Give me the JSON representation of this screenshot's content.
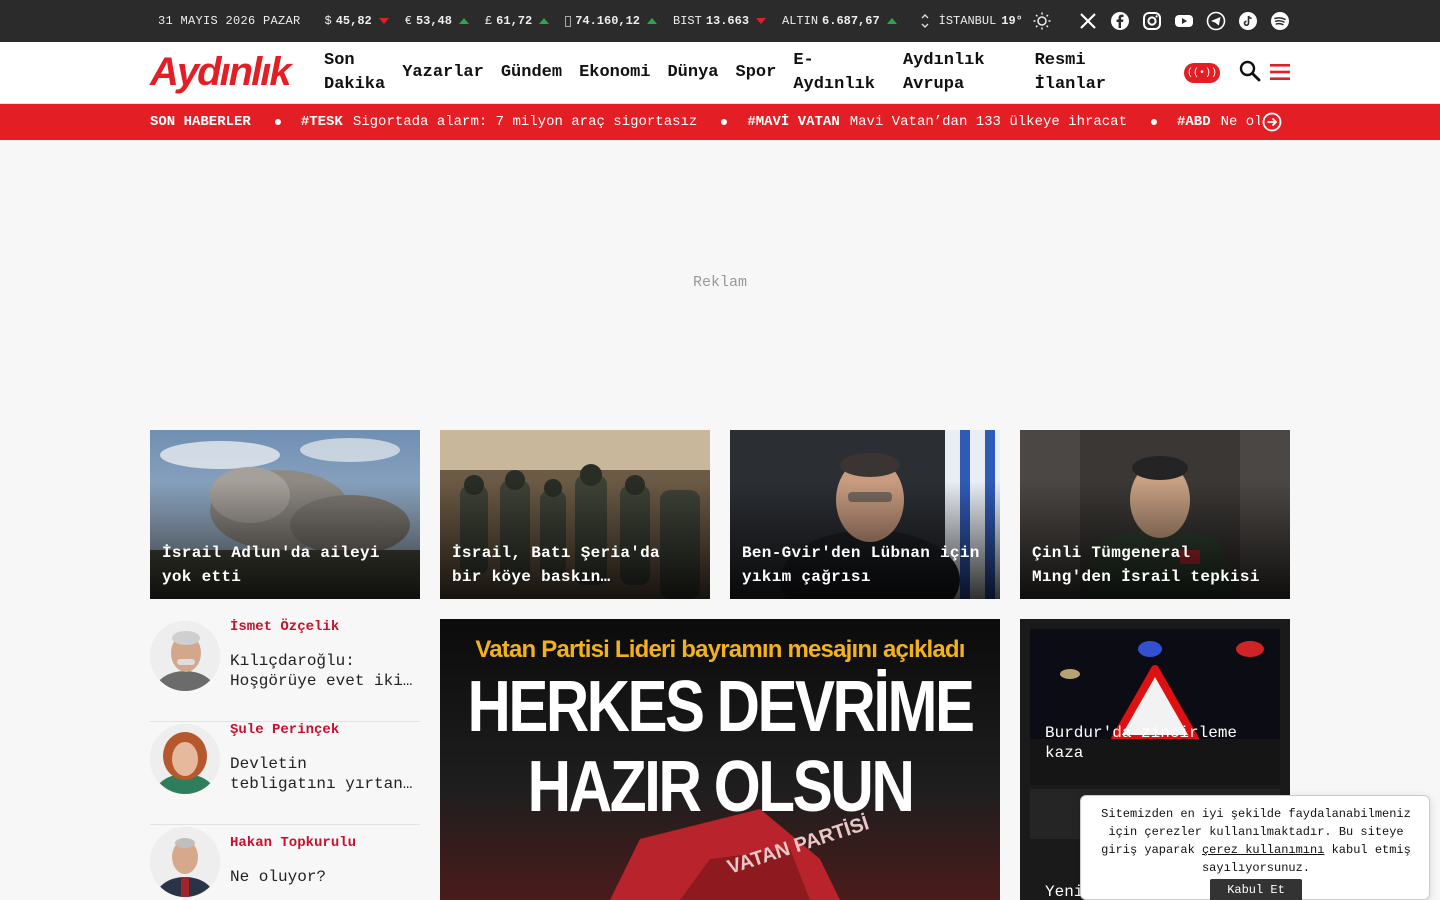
{
  "topbar": {
    "date": "31 MAYIS 2026 PAZAR",
    "tickers": [
      {
        "symbol": "$",
        "value": "45,82",
        "trend": "down"
      },
      {
        "symbol": "€",
        "value": "53,48",
        "trend": "up"
      },
      {
        "symbol": "£",
        "value": "61,72",
        "trend": "up"
      },
      {
        "symbol": "",
        "value": "74.160,12",
        "trend": "up"
      },
      {
        "symbol": "BIST",
        "value": "13.663",
        "trend": "down"
      },
      {
        "symbol": "ALTIN",
        "value": "6.687,67",
        "trend": "up"
      }
    ],
    "city": "İSTANBUL",
    "temperature": "19°",
    "socials": [
      "x-icon",
      "facebook-icon",
      "instagram-icon",
      "youtube-icon",
      "telegram-icon",
      "tiktok-icon",
      "spotify-icon"
    ]
  },
  "header": {
    "logo": "Aydınlık",
    "nav": [
      {
        "line1": "Son",
        "line2": "Dakika"
      },
      {
        "line1": "Yazarlar",
        "line2": ""
      },
      {
        "line1": "Gündem",
        "line2": ""
      },
      {
        "line1": "Ekonomi",
        "line2": ""
      },
      {
        "line1": "Dünya",
        "line2": ""
      },
      {
        "line1": "Spor",
        "line2": ""
      },
      {
        "line1": "E-",
        "line2": "Aydınlık"
      },
      {
        "line1": "Aydınlık",
        "line2": "Avrupa"
      },
      {
        "line1": "Resmi",
        "line2": "İlanlar"
      }
    ],
    "live_label": "((•))"
  },
  "ticker": {
    "head": "SON HABERLER",
    "items": [
      {
        "tag": "#TESK",
        "text": "Sigortada alarm: 7 milyon araç sigortasız"
      },
      {
        "tag": "#MAVİ VATAN",
        "text": "Mavi Vatan’dan 133 ülkeye ihracat"
      },
      {
        "tag": "#ABD",
        "text": "Ne olu"
      }
    ]
  },
  "ad": {
    "label": "Reklam"
  },
  "cards": [
    {
      "line1": "İsrail Adlun'da aileyi",
      "line2": "yok etti"
    },
    {
      "line1": "İsrail, Batı Şeria'da",
      "line2": "bir köye baskın…"
    },
    {
      "line1": "Ben-Gvir'den Lübnan için",
      "line2": "yıkım çağrısı"
    },
    {
      "line1": "Çinli Tümgeneral",
      "line2": "Mıng'den İsrail tepkisi"
    }
  ],
  "authors": [
    {
      "name": "İsmet Özçelik",
      "line1": "Kılıçdaroğlu:",
      "line2": "Hoşgörüye evet iki…"
    },
    {
      "name": "Şule Perinçek",
      "line1": "Devletin",
      "line2": "tebligatını yırtan…"
    },
    {
      "name": "Hakan Topkurulu",
      "line1": "Ne oluyor?",
      "line2": ""
    }
  ],
  "feature": {
    "kicker": "Vatan Partisi Lideri bayramın mesajını açıkladı",
    "headline1": "HERKES DEVRİME",
    "headline2": "HAZIR OLSUN",
    "sign": "VATAN PARTİSİ"
  },
  "right": {
    "title1": "Burdur'da zincirleme",
    "title2": "kaza",
    "title3": "Yeni"
  },
  "cookie": {
    "text1": "Sitemizden en iyi şekilde faydalanabilmeniz için çerezler kullanılmaktadır. Bu siteye giriş yaparak ",
    "link": "çerez kullanımını",
    "text2": " kabul etmiş sayılıyorsunuz.",
    "button": "Kabul Et"
  },
  "colors": {
    "brand": "#e31e24",
    "up": "#2fa34a",
    "down": "#e31e24",
    "topbar": "#2b2b2b"
  }
}
